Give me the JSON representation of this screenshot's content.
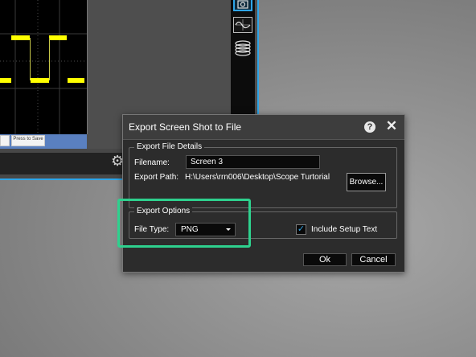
{
  "scope": {
    "softkeys": [
      {
        "label": ""
      },
      {
        "label": "Press to Save"
      }
    ],
    "toolbar_icons": [
      "camera-icon",
      "waveform-icon",
      "disk-stack-icon"
    ],
    "settings_icon": "gear-icon"
  },
  "dialog": {
    "title": "Export Screen Shot to File",
    "help_label": "?",
    "close_label": "✕",
    "details": {
      "group_title": "Export File Details",
      "filename_label": "Filename:",
      "filename_value": "Screen 3",
      "path_label": "Export Path:",
      "path_value": "H:\\Users\\rrn006\\Desktop\\Scope Turtorial",
      "browse_label": "Browse..."
    },
    "options": {
      "group_title": "Export Options",
      "filetype_label": "File Type:",
      "filetype_value": "PNG",
      "include_setup_label": "Include Setup Text",
      "include_setup_checked": true
    },
    "ok_label": "Ok",
    "cancel_label": "Cancel"
  },
  "colors": {
    "accent": "#2ea5e8",
    "highlight": "#2ed18e",
    "waveform": "#ffff00"
  }
}
